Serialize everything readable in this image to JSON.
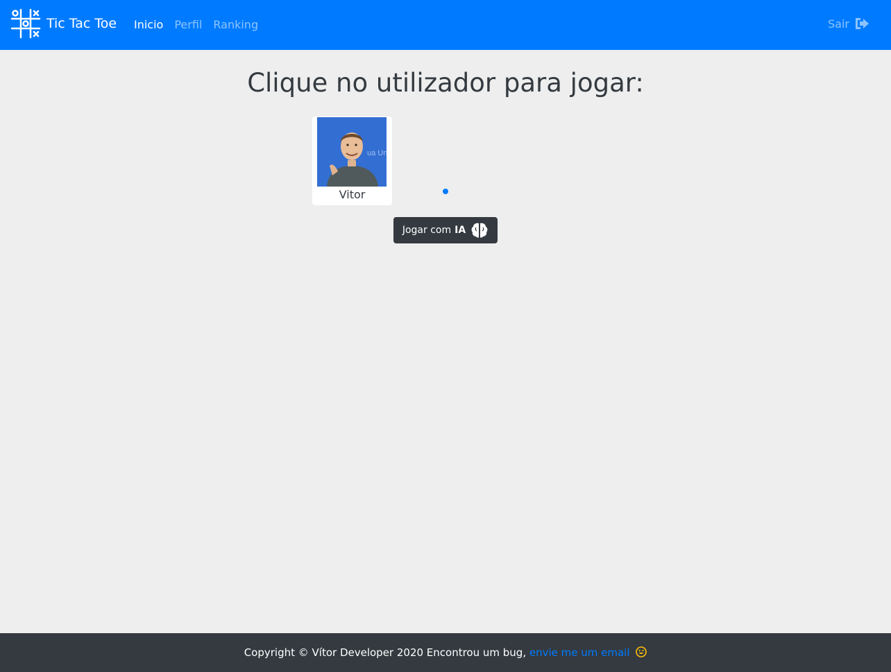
{
  "navbar": {
    "brand": "Tic Tac Toe",
    "brand_icon": "tic-tac-toe-logo-icon",
    "links": [
      "Inicio",
      "Perfil",
      "Ranking"
    ],
    "active_link": "Inicio",
    "logout_label": "Sair",
    "logout_icon": "sign-out-icon",
    "color": "#007bff"
  },
  "main": {
    "title": "Clique no utilizador para jogar:",
    "users": [
      {
        "name": "Vitor"
      }
    ],
    "ai_button": {
      "prefix": "Jogar com",
      "strong": "IA",
      "icon": "brain-icon"
    }
  },
  "footer": {
    "text": "Copyright © Vítor Developer 2020 Encontrou um bug,",
    "link": "envie me um email",
    "icon": "smile-icon"
  }
}
